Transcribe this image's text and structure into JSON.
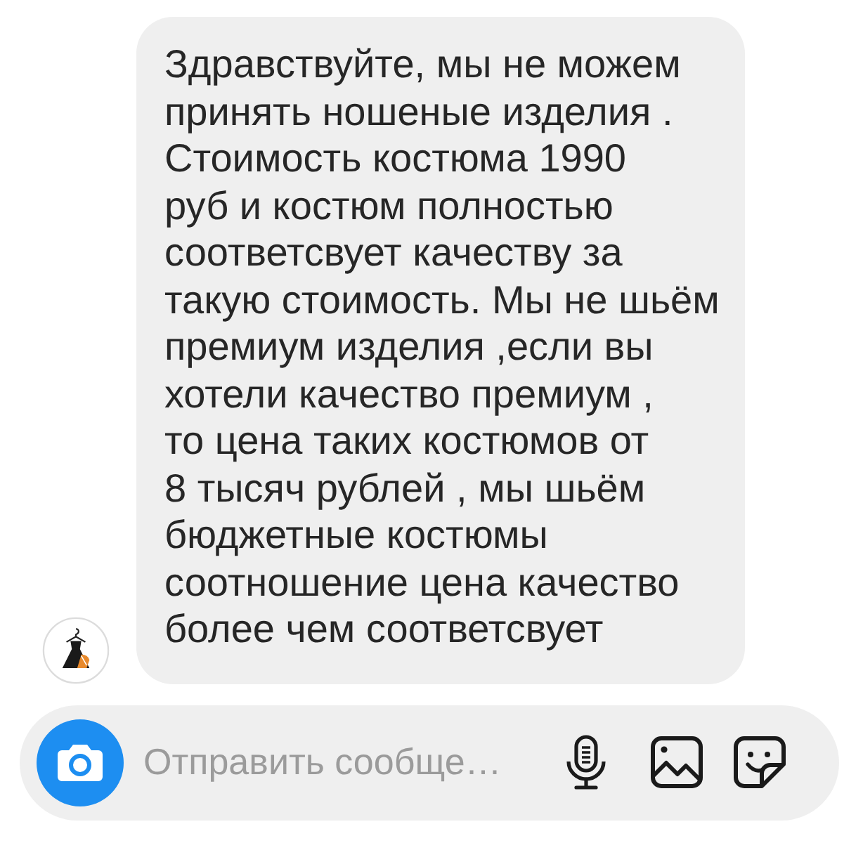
{
  "conversation": {
    "messages": [
      {
        "text": "Здравствуйте, мы не можем\nпринять ношеные изделия .\nСтоимость костюма 1990\nруб и костюм полностью\nсоответсвует качеству за\nтакую стоимость. Мы не шьём\nпремиум изделия ,если вы\nхотели качество премиум ,\nто цена таких костюмов от\n8 тысяч рублей , мы шьём\nбюджетные костюмы\nсоотношение цена качество\nболее чем соответсвует"
      }
    ]
  },
  "composer": {
    "placeholder": "Отправить сообще…"
  }
}
